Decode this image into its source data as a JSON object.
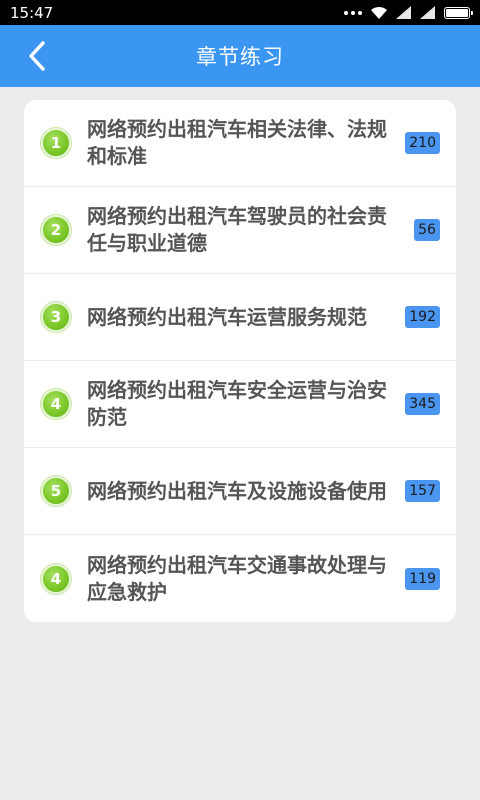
{
  "status_bar": {
    "time": "15:47",
    "icons": [
      "signal-dots-icon",
      "wifi-icon",
      "cell-signal-icon",
      "cell-signal-icon",
      "battery-icon"
    ]
  },
  "app_bar": {
    "title": "章节练习",
    "back_icon": "chevron-left-icon"
  },
  "chapters": [
    {
      "number": "1",
      "title": "网络预约出租汽车相关法律、法规和标准",
      "count": "210"
    },
    {
      "number": "2",
      "title": "网络预约出租汽车驾驶员的社会责任与职业道德",
      "count": "56"
    },
    {
      "number": "3",
      "title": "网络预约出租汽车运营服务规范",
      "count": "192"
    },
    {
      "number": "4",
      "title": "网络预约出租汽车安全运营与治安防范",
      "count": "345"
    },
    {
      "number": "5",
      "title": "网络预约出租汽车及设施设备使用",
      "count": "157"
    },
    {
      "number": "4",
      "title": "网络预约出租汽车交通事故处理与应急救护",
      "count": "119"
    }
  ],
  "colors": {
    "app_bar": "#3b96f2",
    "badge_green": "#7cc82a",
    "count_badge": "#4a95ef",
    "background": "#ececec"
  }
}
